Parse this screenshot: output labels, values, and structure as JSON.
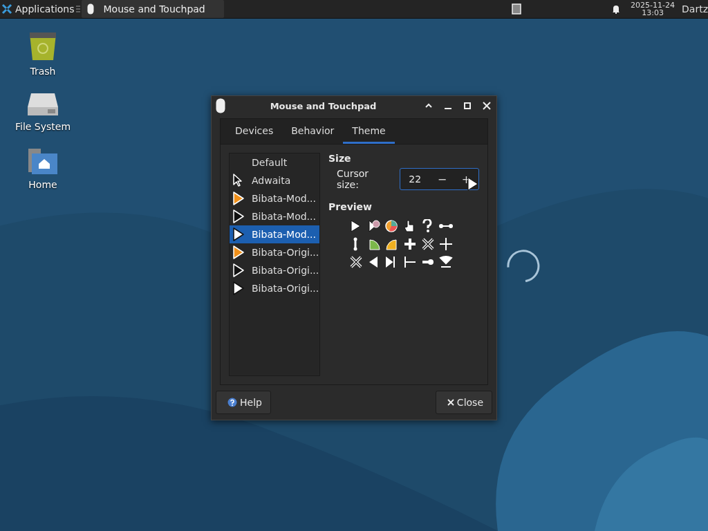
{
  "taskbar": {
    "app_menu": "Applications",
    "tasks": [
      {
        "title": "Mouse and Touchpad"
      }
    ],
    "clock": {
      "date": "2025-11-24",
      "time": "13:03"
    },
    "user": "Dartz"
  },
  "desktop_icons": [
    {
      "label": "Trash",
      "kind": "trash"
    },
    {
      "label": "File System",
      "kind": "drive"
    },
    {
      "label": "Home",
      "kind": "home"
    }
  ],
  "window": {
    "title": "Mouse and Touchpad",
    "tabs": [
      {
        "label": "Devices",
        "selected": false
      },
      {
        "label": "Behavior",
        "selected": false
      },
      {
        "label": "Theme",
        "selected": true
      }
    ],
    "themes": [
      {
        "name": "Default",
        "kind": "none",
        "selected": false
      },
      {
        "name": "Adwaita",
        "kind": "outline",
        "selected": false
      },
      {
        "name": "Bibata-Mod...",
        "kind": "orange",
        "selected": false
      },
      {
        "name": "Bibata-Mod...",
        "kind": "black",
        "selected": false
      },
      {
        "name": "Bibata-Mod...",
        "kind": "white",
        "selected": true
      },
      {
        "name": "Bibata-Origi...",
        "kind": "orange",
        "selected": false
      },
      {
        "name": "Bibata-Origi...",
        "kind": "black",
        "selected": false
      },
      {
        "name": "Bibata-Origi...",
        "kind": "white",
        "selected": false
      }
    ],
    "size": {
      "heading": "Size",
      "label": "Cursor size:",
      "value": "22",
      "minus": "−",
      "plus": "+"
    },
    "preview": {
      "heading": "Preview"
    },
    "buttons": [
      {
        "label": "Help",
        "kind": "help"
      },
      {
        "label": "Close",
        "kind": "close"
      }
    ]
  }
}
